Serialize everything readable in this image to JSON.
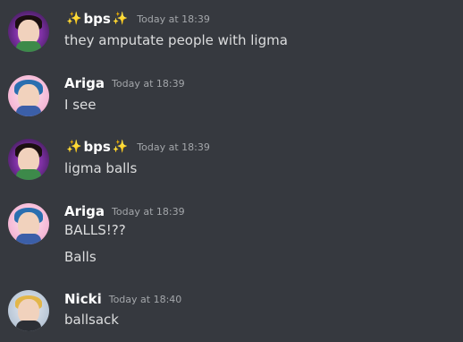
{
  "messages": [
    {
      "author": "bps",
      "author_decor": "✨",
      "timestamp": "Today at 18:39",
      "lines": [
        "they amputate people with ligma"
      ]
    },
    {
      "author": "Ariga",
      "timestamp": "Today at 18:39",
      "lines": [
        "I see"
      ]
    },
    {
      "author": "bps",
      "author_decor": "✨",
      "timestamp": "Today at 18:39",
      "lines": [
        "ligma balls"
      ]
    },
    {
      "author": "Ariga",
      "timestamp": "Today at 18:39",
      "lines": [
        "BALLS!??",
        "Balls"
      ]
    },
    {
      "author": "Nicki",
      "timestamp": "Today at 18:40",
      "lines": [
        "ballsack"
      ]
    }
  ],
  "colors": {
    "background": "#36393f",
    "username": "#ffffff",
    "text": "#dcddde",
    "timestamp": "#a3a6aa",
    "sparkle": "#f7d154"
  },
  "icons": {
    "author_decor": "sparkles-icon"
  }
}
